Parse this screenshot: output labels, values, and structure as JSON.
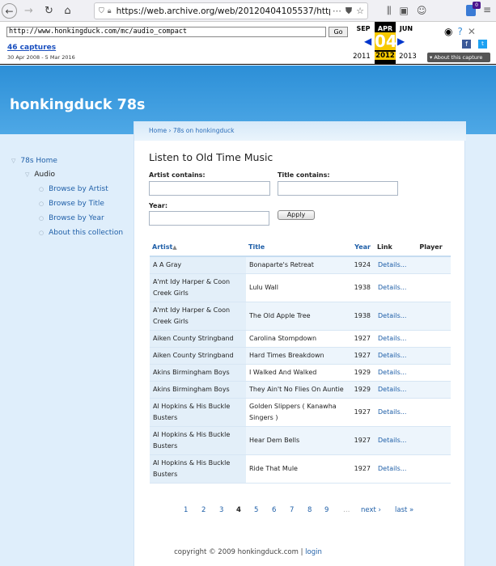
{
  "browser": {
    "url": "https://web.archive.org/web/20120404105537/http://w"
  },
  "wayback": {
    "url_field": "http://www.honkingduck.com/mc/audio_compact",
    "go_label": "Go",
    "captures": "46 captures",
    "range": "30 Apr 2008 - 5 Mar 2016",
    "months": [
      "SEP",
      "APR",
      "JUN"
    ],
    "day": "04",
    "years": [
      "2011",
      "2012",
      "2013"
    ],
    "about": "About this capture"
  },
  "site": {
    "title": "honkingduck 78s",
    "breadcrumb": "Home › 78s on honkingduck"
  },
  "sidebar": {
    "items": [
      {
        "label": "78s Home"
      },
      {
        "label": "Audio"
      },
      {
        "label": "Browse by Artist"
      },
      {
        "label": "Browse by Title"
      },
      {
        "label": "Browse by Year"
      },
      {
        "label": "About this collection"
      }
    ]
  },
  "form": {
    "heading": "Listen to Old Time Music",
    "artist_label": "Artist contains:",
    "title_label": "Title contains:",
    "year_label": "Year:",
    "apply_label": "Apply"
  },
  "table": {
    "headers": {
      "artist": "Artist",
      "sort_arrow": "▲",
      "title": "Title",
      "year": "Year",
      "link": "Link",
      "player": "Player"
    },
    "rows": [
      {
        "artist": "A A Gray",
        "title": "Bonaparte's Retreat",
        "year": "1924",
        "link": "Details..."
      },
      {
        "artist": "A'mt Idy Harper & Coon Creek Girls",
        "title": "Lulu Wall",
        "year": "1938",
        "link": "Details..."
      },
      {
        "artist": "A'mt Idy Harper & Coon Creek Girls",
        "title": "The Old Apple Tree",
        "year": "1938",
        "link": "Details..."
      },
      {
        "artist": "Aiken County Stringband",
        "title": "Carolina Stompdown",
        "year": "1927",
        "link": "Details..."
      },
      {
        "artist": "Aiken County Stringband",
        "title": "Hard Times Breakdown",
        "year": "1927",
        "link": "Details..."
      },
      {
        "artist": "Akins Birmingham Boys",
        "title": "I Walked And Walked",
        "year": "1929",
        "link": "Details..."
      },
      {
        "artist": "Akins Birmingham Boys",
        "title": "They Ain't No Flies On Auntie",
        "year": "1929",
        "link": "Details..."
      },
      {
        "artist": "Al Hopkins & His Buckle Busters",
        "title": "Golden Slippers ( Kanawha Singers )",
        "year": "1927",
        "link": "Details..."
      },
      {
        "artist": "Al Hopkins & His Buckle Busters",
        "title": "Hear Dem Bells",
        "year": "1927",
        "link": "Details..."
      },
      {
        "artist": "Al Hopkins & His Buckle Busters",
        "title": "Ride That Mule",
        "year": "1927",
        "link": "Details..."
      }
    ]
  },
  "pager": {
    "pages": [
      "1",
      "2",
      "3",
      "4",
      "5",
      "6",
      "7",
      "8",
      "9"
    ],
    "current": "4",
    "dots": "…",
    "next": "next ›",
    "last": "last »"
  },
  "footer": {
    "copyright": "copyright © 2009 honkingduck.com | ",
    "login": "login"
  }
}
